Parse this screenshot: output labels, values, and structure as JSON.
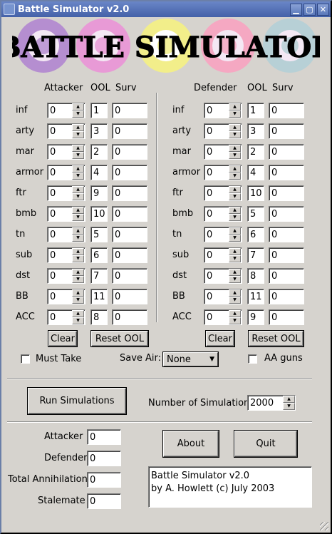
{
  "window": {
    "title": "Battle Simulator v2.0",
    "controls": [
      "✕",
      "▢",
      "▁"
    ]
  },
  "banner": {
    "text": "BATTLE SIMULATOR",
    "roundel_colors": [
      "#b58ed0",
      "#e89ad6",
      "#f2ee8a",
      "#f5a8c2",
      "#b7d0d6"
    ]
  },
  "attacker": {
    "header": "Attacker",
    "ool_header": "OOL",
    "surv_header": "Surv",
    "rows": [
      {
        "label": "inf",
        "count": "0",
        "ool": "1",
        "surv": "0"
      },
      {
        "label": "arty",
        "count": "0",
        "ool": "3",
        "surv": "0"
      },
      {
        "label": "mar",
        "count": "0",
        "ool": "2",
        "surv": "0"
      },
      {
        "label": "armor",
        "count": "0",
        "ool": "4",
        "surv": "0"
      },
      {
        "label": "ftr",
        "count": "0",
        "ool": "9",
        "surv": "0"
      },
      {
        "label": "bmb",
        "count": "0",
        "ool": "10",
        "surv": "0"
      },
      {
        "label": "tn",
        "count": "0",
        "ool": "5",
        "surv": "0"
      },
      {
        "label": "sub",
        "count": "0",
        "ool": "6",
        "surv": "0"
      },
      {
        "label": "dst",
        "count": "0",
        "ool": "7",
        "surv": "0"
      },
      {
        "label": "BB",
        "count": "0",
        "ool": "11",
        "surv": "0"
      },
      {
        "label": "ACC",
        "count": "0",
        "ool": "8",
        "surv": "0"
      }
    ],
    "clear_label": "Clear",
    "reset_label": "Reset OOL"
  },
  "defender": {
    "header": "Defender",
    "ool_header": "OOL",
    "surv_header": "Surv",
    "rows": [
      {
        "label": "inf",
        "count": "0",
        "ool": "1",
        "surv": "0"
      },
      {
        "label": "arty",
        "count": "0",
        "ool": "3",
        "surv": "0"
      },
      {
        "label": "mar",
        "count": "0",
        "ool": "2",
        "surv": "0"
      },
      {
        "label": "armor",
        "count": "0",
        "ool": "4",
        "surv": "0"
      },
      {
        "label": "ftr",
        "count": "0",
        "ool": "10",
        "surv": "0"
      },
      {
        "label": "bmb",
        "count": "0",
        "ool": "5",
        "surv": "0"
      },
      {
        "label": "tn",
        "count": "0",
        "ool": "6",
        "surv": "0"
      },
      {
        "label": "sub",
        "count": "0",
        "ool": "7",
        "surv": "0"
      },
      {
        "label": "dst",
        "count": "0",
        "ool": "8",
        "surv": "0"
      },
      {
        "label": "BB",
        "count": "0",
        "ool": "11",
        "surv": "0"
      },
      {
        "label": "ACC",
        "count": "0",
        "ool": "9",
        "surv": "0"
      }
    ],
    "clear_label": "Clear",
    "reset_label": "Reset OOL"
  },
  "options": {
    "must_take_label": "Must Take",
    "save_air_label": "Save Air:",
    "save_air_value": "None",
    "aa_guns_label": "AA guns"
  },
  "simulation": {
    "run_label": "Run Simulations",
    "num_label": "Number of Simulations:",
    "num_value": "2000"
  },
  "results": {
    "attacker_label": "Attacker",
    "attacker_value": "0",
    "defender_label": "Defender",
    "defender_value": "0",
    "annihilation_label": "Total Annihilation",
    "annihilation_value": "0",
    "stalemate_label": "Stalemate",
    "stalemate_value": "0"
  },
  "about_label": "About",
  "quit_label": "Quit",
  "info": {
    "line1": "Battle Simulator v2.0",
    "line2": "by A. Howlett (c) July 2003"
  }
}
